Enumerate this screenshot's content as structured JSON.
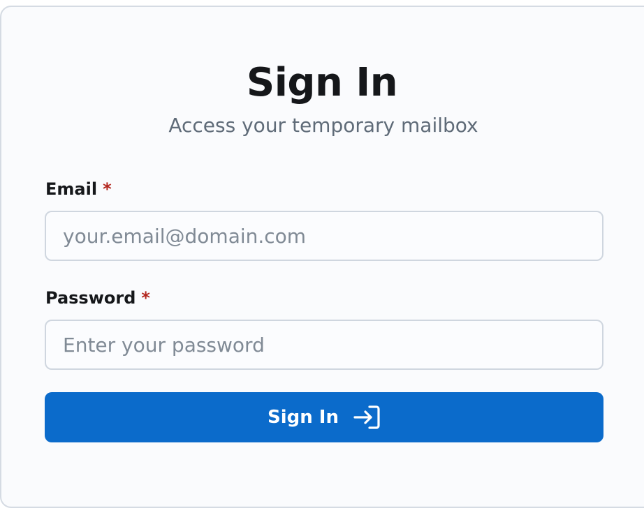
{
  "header": {
    "title": "Sign In",
    "subtitle": "Access your temporary mailbox"
  },
  "form": {
    "email": {
      "label": "Email",
      "required_marker": "*",
      "placeholder": "your.email@domain.com",
      "value": ""
    },
    "password": {
      "label": "Password",
      "required_marker": "*",
      "placeholder": "Enter your password",
      "value": ""
    },
    "submit": {
      "label": "Sign In",
      "icon": "login-arrow-icon"
    }
  },
  "colors": {
    "primary": "#0b6bcb",
    "required": "#b3261e",
    "card_bg": "#fafbfd",
    "border": "#d5dbe3"
  }
}
